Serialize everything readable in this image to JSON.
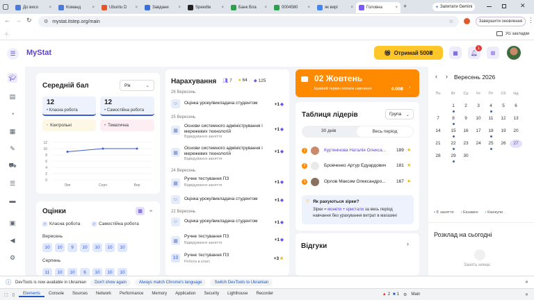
{
  "browser": {
    "tabs": [
      {
        "title": "До висо",
        "color": "#4b7bd6"
      },
      {
        "title": "Команд",
        "color": "#4b7bd6"
      },
      {
        "title": "Ubuntu D",
        "color": "#e4572e"
      },
      {
        "title": "Завдани",
        "color": "#3a6fd8"
      },
      {
        "title": "Speedte",
        "color": "#222"
      },
      {
        "title": "Банк Вла",
        "color": "#2d9f4f"
      },
      {
        "title": "0004580",
        "color": "#2d9f4f"
      },
      {
        "title": "як вирі",
        "color": "#4285f4"
      },
      {
        "title": "Головна",
        "color": "#7a5af8"
      }
    ],
    "new_tab": "+",
    "gemini": "Запитати Gemini",
    "url": "mystat.itstep.org/main",
    "update_button": "Завершити оновлення",
    "bookmarks": "Усі закладки"
  },
  "app": {
    "logo": "MyStat",
    "bonus_button": "Отримай 500₴",
    "notif_count": "1"
  },
  "avg": {
    "title": "Середній бал",
    "period": "Рік",
    "class_value": "12",
    "class_label": "Класна робота",
    "indep_value": "12",
    "indep_label": "Самостійна робота",
    "control": "Контрольні",
    "thematic": "Тематична",
    "y_ticks": [
      "12",
      "10",
      "8",
      "6",
      "4",
      "2",
      "0"
    ],
    "x_ticks": [
      "Лип",
      "Серп",
      "Вер"
    ]
  },
  "chart_data": {
    "type": "line",
    "categories": [
      "Лип",
      "Серп",
      "Вер"
    ],
    "values": [
      9,
      10,
      10
    ],
    "ylim": [
      0,
      12
    ],
    "x_ticks": [
      "Лип",
      "Серп",
      "Вер"
    ],
    "y_ticks": [
      "12",
      "10",
      "8",
      "6",
      "4",
      "2",
      "0"
    ]
  },
  "grades": {
    "title": "Оцінки",
    "chk1": "Класна робота",
    "chk2": "Самостійна робота",
    "month1": "Вересень",
    "row1": [
      "10",
      "10",
      "9",
      "10",
      "10",
      "10",
      "10"
    ],
    "month2": "Серпень",
    "row2": [
      "11",
      "10",
      "10",
      "6",
      "10",
      "10",
      "10"
    ]
  },
  "accruals": {
    "title": "Нарахування",
    "stat1": "7",
    "stat2": "64",
    "stat3": "125",
    "d1": "26 Вересень",
    "d2": "25 Вересень",
    "d3": "24 Вересень",
    "d4": "22 Вересень",
    "items": [
      {
        "title": "Оцінка уроку/викладача студентом",
        "sub": "",
        "val": "+1"
      },
      {
        "title": "Основи системного адміністрування і мережевих технологій",
        "sub": "Відвідування заняття",
        "val": "+1"
      },
      {
        "title": "Основи системного адміністрування і мережевих технологій",
        "sub": "Відвідування заняття",
        "val": "+1"
      },
      {
        "title": "Ручне тестування ПЗ",
        "sub": "Відвідування заняття",
        "val": "+1"
      },
      {
        "title": "Оцінка уроку/викладача студентом",
        "sub": "",
        "val": "+1"
      },
      {
        "title": "Оцінка уроку/викладача студентом",
        "sub": "",
        "val": "+1"
      },
      {
        "title": "Ручне тестування ПЗ",
        "sub": "Відвідування заняття",
        "val": "+1"
      },
      {
        "title": "Ручне тестування ПЗ",
        "sub": "Робота в класі",
        "val": "+3",
        "badge": "10"
      }
    ]
  },
  "payment": {
    "date": "02 Жовтень",
    "note": "Крайній термін оплати навчання",
    "amount": "0.00₴"
  },
  "leaders": {
    "title": "Таблиця лідерів",
    "group": "Група",
    "tab1": "30 днів",
    "tab2": "Весь період",
    "rows": [
      {
        "rank": "1",
        "name": "Кур'янінова Наталія Олекса...",
        "score": "189"
      },
      {
        "rank": "2",
        "name": "Бровченко Артур Едуардович",
        "score": "181"
      },
      {
        "rank": "3",
        "name": "Орлов Максим Олександро...",
        "score": "167"
      }
    ],
    "info_title": "Як рахуються зірки?",
    "info_lead": "Зірки = ",
    "info_hl": "монети + кристали",
    "info_rest": " за весь період навчання без урахування витрат в магазині"
  },
  "reviews": {
    "title": "Відгуки"
  },
  "calendar": {
    "month": "Вересень 2026",
    "weekdays": [
      "Пн",
      "Вт",
      "Ср",
      "Чт",
      "Пт",
      "Сб",
      "Нд"
    ],
    "weeks": [
      [
        "",
        "1",
        "2",
        "3",
        "4",
        "5",
        "6"
      ],
      [
        "7",
        "8",
        "9",
        "10",
        "11",
        "12",
        "13"
      ],
      [
        "14",
        "15",
        "16",
        "17",
        "18",
        "19",
        "20"
      ],
      [
        "21",
        "22",
        "23",
        "24",
        "25",
        "26",
        "27"
      ],
      [
        "28",
        "29",
        "30",
        "",
        "",
        "",
        ""
      ]
    ],
    "legend1": "Є заняття",
    "legend2": "Екзамен",
    "legend3": "Канікули",
    "schedule_title": "Розклад на сьогодні",
    "no_lessons": "Занять немає"
  },
  "devtools": {
    "info": "DevTools is now available in Ukrainian",
    "btn1": "Don't show again",
    "btn2": "Always match Chrome's language",
    "btn3": "Switch DevTools to Ukrainian",
    "tabs": [
      "Elements",
      "Console",
      "Sources",
      "Network",
      "Performance",
      "Memory",
      "Application",
      "Security",
      "Lighthouse",
      "Recorder"
    ],
    "errors": "2",
    "warnings": "1",
    "context": "Main"
  }
}
